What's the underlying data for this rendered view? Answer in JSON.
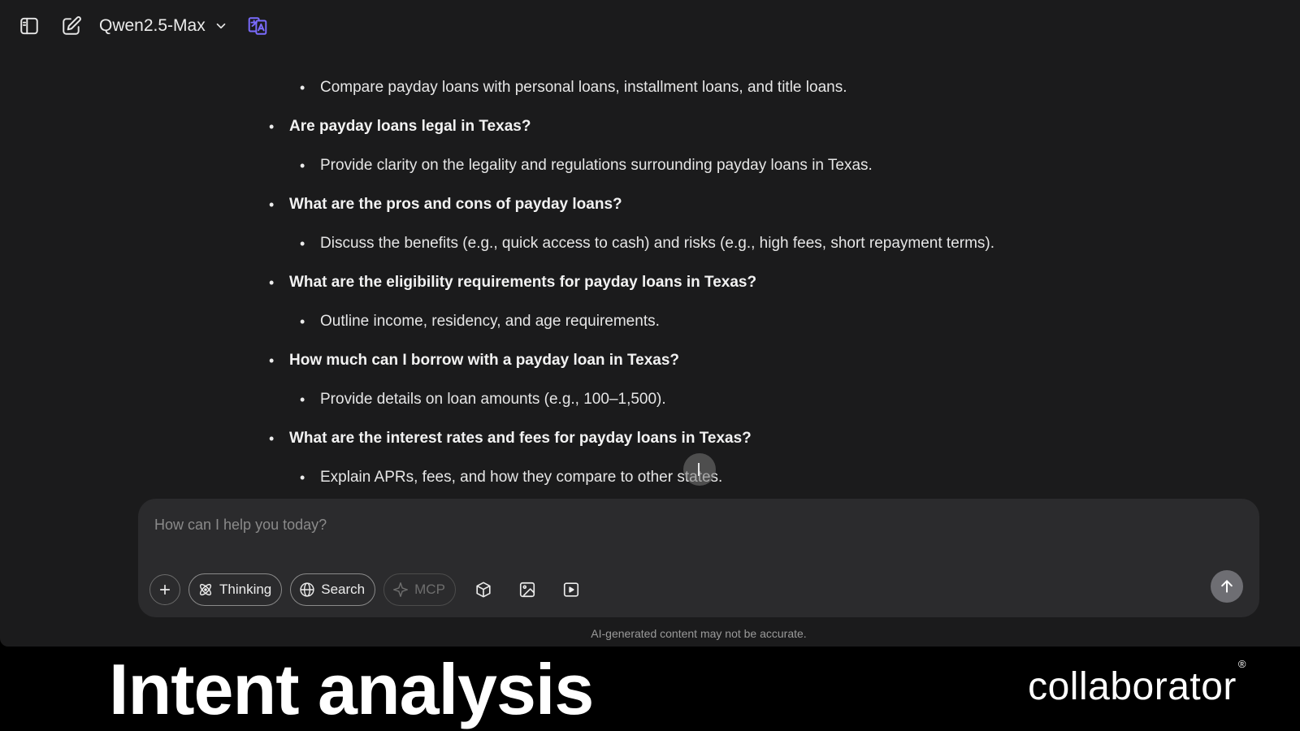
{
  "header": {
    "model_name": "Qwen2.5-Max",
    "icons": [
      "sidebar-toggle-icon",
      "new-chat-icon",
      "chevron-down-icon",
      "translate-icon"
    ],
    "accent_color": "#7b6cff"
  },
  "content": {
    "lines": [
      {
        "type": "sub",
        "text": "Compare payday loans with personal loans, installment loans, and title loans."
      },
      {
        "type": "question",
        "text": "Are payday loans legal in Texas?"
      },
      {
        "type": "sub",
        "text": "Provide clarity on the legality and regulations surrounding payday loans in Texas."
      },
      {
        "type": "question",
        "text": "What are the pros and cons of payday loans?"
      },
      {
        "type": "sub",
        "text": "Discuss the benefits (e.g., quick access to cash) and risks (e.g., high fees, short repayment terms)."
      },
      {
        "type": "question",
        "text": "What are the eligibility requirements for payday loans in Texas?"
      },
      {
        "type": "sub",
        "text": "Outline income, residency, and age requirements."
      },
      {
        "type": "question",
        "text": "How much can I borrow with a payday loan in Texas?"
      },
      {
        "type": "sub",
        "text": "Provide details on loan amounts (e.g., 100–1,500)."
      },
      {
        "type": "question",
        "text": "What are the interest rates and fees for payday loans in Texas?"
      },
      {
        "type": "sub",
        "text": "Explain APRs, fees, and how they compare to other states."
      }
    ]
  },
  "composer": {
    "placeholder": "How can I help you today?",
    "thinking_label": "Thinking",
    "search_label": "Search",
    "mcp_label": "MCP"
  },
  "disclaimer": "AI-generated content may not be accurate.",
  "banner": {
    "title": "Intent analysis",
    "brand": "collaborator",
    "brand_mark": "®"
  }
}
